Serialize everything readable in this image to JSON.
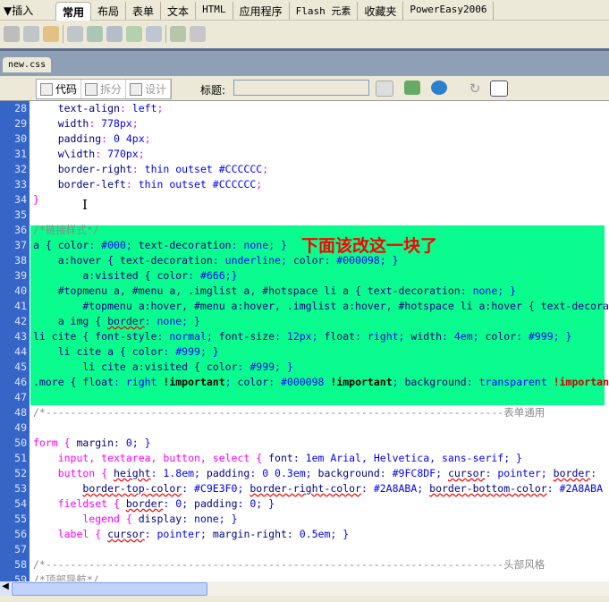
{
  "insert_bar": {
    "title": "▼插入",
    "tabs": [
      "常用",
      "布局",
      "表单",
      "文本",
      "HTML",
      "应用程序",
      "Flash 元素",
      "收藏夹",
      "PowerEasy2006"
    ],
    "active": "常用"
  },
  "icons": [
    "hyperlink-icon",
    "email-icon",
    "anchor-icon",
    "table-icon",
    "image-icon",
    "media-icon",
    "date-icon",
    "comment-icon",
    "template-icon",
    "tag-chooser-icon"
  ],
  "document": {
    "tab": "new.css"
  },
  "doc_toolbar": {
    "code": "代码",
    "split": "拆分",
    "design": "设计",
    "title_label": "标题:",
    "title_value": ""
  },
  "editor": {
    "lines": [
      {
        "n": "28",
        "t": [
          [
            "    text-align",
            "p"
          ],
          [
            ": ",
            "b"
          ],
          [
            "left",
            "v"
          ],
          [
            ";",
            "b"
          ]
        ]
      },
      {
        "n": "29",
        "t": [
          [
            "    width",
            "p"
          ],
          [
            ": ",
            "b"
          ],
          [
            "778px",
            "v"
          ],
          [
            ";",
            "b"
          ]
        ]
      },
      {
        "n": "30",
        "t": [
          [
            "    padding",
            "p"
          ],
          [
            ": ",
            "b"
          ],
          [
            "0 4px",
            "v"
          ],
          [
            ";",
            "b"
          ]
        ]
      },
      {
        "n": "31",
        "t": [
          [
            "    w\\idth",
            "p"
          ],
          [
            ": ",
            "b"
          ],
          [
            "770px",
            "v"
          ],
          [
            ";",
            "b"
          ]
        ]
      },
      {
        "n": "32",
        "t": [
          [
            "    border-right",
            "p"
          ],
          [
            ": ",
            "b"
          ],
          [
            "thin outset #CCCCCC",
            "v"
          ],
          [
            ";",
            "b"
          ]
        ]
      },
      {
        "n": "33",
        "t": [
          [
            "    border-left",
            "p"
          ],
          [
            ": ",
            "b"
          ],
          [
            "thin outset #CCCCCC",
            "v"
          ],
          [
            ";",
            "b"
          ]
        ]
      },
      {
        "n": "34",
        "t": [
          [
            "}",
            "b"
          ]
        ]
      },
      {
        "n": "35",
        "t": []
      },
      {
        "n": "36",
        "t": [
          [
            "/*链接样式*/",
            "c"
          ]
        ]
      },
      {
        "n": "37",
        "t": [
          [
            "a { ",
            "n"
          ],
          [
            "color",
            "p"
          ],
          [
            ": #000; ",
            "v"
          ],
          [
            "text-decoration",
            "p"
          ],
          [
            ": none; }",
            "v"
          ]
        ]
      },
      {
        "n": "38",
        "t": [
          [
            "    a:hover { ",
            "n"
          ],
          [
            "text-decoration",
            "p"
          ],
          [
            ": underline; ",
            "v"
          ],
          [
            "color",
            "p"
          ],
          [
            ": #000098; }",
            "v"
          ]
        ]
      },
      {
        "n": "39",
        "t": [
          [
            "        a:visited { ",
            "n"
          ],
          [
            "color",
            "p"
          ],
          [
            ": #666;}",
            "v"
          ]
        ]
      },
      {
        "n": "40",
        "t": [
          [
            "    #topmenu a, #menu a, .imglist a, #hotspace li a { ",
            "n"
          ],
          [
            "text-decoration",
            "p"
          ],
          [
            ": none; }",
            "v"
          ]
        ]
      },
      {
        "n": "41",
        "t": [
          [
            "        #topmenu a:hover, #menu a:hover, .imglist a:hover, #hotspace li a:hover { ",
            "n"
          ],
          [
            "text-decoration",
            "p"
          ]
        ]
      },
      {
        "n": "42",
        "t": [
          [
            "    a img { ",
            "n"
          ],
          [
            "border",
            "p u"
          ],
          [
            ": none; }",
            "v"
          ]
        ]
      },
      {
        "n": "43",
        "t": [
          [
            "li cite { ",
            "n"
          ],
          [
            "font-style",
            "p"
          ],
          [
            ": normal; ",
            "v"
          ],
          [
            "font-size",
            "p"
          ],
          [
            ": 12px; ",
            "v"
          ],
          [
            "float",
            "p"
          ],
          [
            ": right; ",
            "v"
          ],
          [
            "width",
            "p"
          ],
          [
            ": 4em; ",
            "v"
          ],
          [
            "color",
            "p"
          ],
          [
            ": #999; }",
            "v"
          ]
        ]
      },
      {
        "n": "44",
        "t": [
          [
            "    li cite a { ",
            "n"
          ],
          [
            "color",
            "p"
          ],
          [
            ": #999; }",
            "v"
          ]
        ]
      },
      {
        "n": "45",
        "t": [
          [
            "        li cite a:visited { ",
            "n"
          ],
          [
            "color",
            "p"
          ],
          [
            ": #999; }",
            "v"
          ]
        ]
      },
      {
        "n": "46",
        "t": [
          [
            ".more { ",
            "n"
          ],
          [
            "float",
            "p"
          ],
          [
            ": right ",
            "v"
          ],
          [
            "!important",
            "i"
          ],
          [
            "; ",
            "v"
          ],
          [
            "color",
            "p"
          ],
          [
            ": #000098 ",
            "v"
          ],
          [
            "!important",
            "i"
          ],
          [
            "; ",
            "v"
          ],
          [
            "background",
            "p"
          ],
          [
            ": transparent ",
            "v"
          ],
          [
            "!important",
            "r"
          ]
        ]
      },
      {
        "n": "47",
        "t": []
      },
      {
        "n": "48",
        "t": [
          [
            "/*--------------------------------------------------------------------------表单通用",
            "c"
          ]
        ]
      },
      {
        "n": "49",
        "t": []
      },
      {
        "n": "50",
        "t": [
          [
            "form ",
            "s"
          ],
          [
            "{ ",
            "b"
          ],
          [
            "margin",
            "p"
          ],
          [
            ": 0; }",
            "v"
          ]
        ]
      },
      {
        "n": "51",
        "t": [
          [
            "    input, textarea, button, select ",
            "s"
          ],
          [
            "{ ",
            "b"
          ],
          [
            "font",
            "p"
          ],
          [
            ": 1em Arial, Helvetica, sans-serif; }",
            "v"
          ]
        ]
      },
      {
        "n": "52",
        "t": [
          [
            "    button ",
            "s"
          ],
          [
            "{ ",
            "b"
          ],
          [
            "height",
            "p u"
          ],
          [
            ": 1.8em; ",
            "v"
          ],
          [
            "padding",
            "p"
          ],
          [
            ": 0 0.3em; ",
            "v"
          ],
          [
            "background",
            "p"
          ],
          [
            ": #9FC8DF; ",
            "v"
          ],
          [
            "cursor",
            "p u"
          ],
          [
            ": pointer; ",
            "v"
          ],
          [
            "border",
            "p u"
          ],
          [
            ":",
            "v"
          ]
        ]
      },
      {
        "n": "53",
        "t": [
          [
            "        ",
            "v"
          ],
          [
            "border-top-color",
            "p u"
          ],
          [
            ": #C9E3F0; ",
            "v"
          ],
          [
            "border-right-color",
            "p u"
          ],
          [
            ": #2A8ABA; ",
            "v"
          ],
          [
            "border-bottom-color",
            "p u"
          ],
          [
            ": #2A8ABA",
            "v"
          ]
        ]
      },
      {
        "n": "54",
        "t": [
          [
            "    fieldset ",
            "s"
          ],
          [
            "{ ",
            "b"
          ],
          [
            "border",
            "p u"
          ],
          [
            ": 0; ",
            "v"
          ],
          [
            "padding",
            "p"
          ],
          [
            ": 0; }",
            "v"
          ]
        ]
      },
      {
        "n": "55",
        "t": [
          [
            "        legend ",
            "s"
          ],
          [
            "{ ",
            "b"
          ],
          [
            "display",
            "p"
          ],
          [
            ": none; }",
            "v"
          ]
        ]
      },
      {
        "n": "56",
        "t": [
          [
            "    label ",
            "s"
          ],
          [
            "{ ",
            "b"
          ],
          [
            "cursor",
            "p u"
          ],
          [
            ": pointer; ",
            "v"
          ],
          [
            "margin-right",
            "p"
          ],
          [
            ": 0.5em; }",
            "v"
          ]
        ]
      },
      {
        "n": "57",
        "t": []
      },
      {
        "n": "58",
        "t": [
          [
            "/*--------------------------------------------------------------------------头部风格",
            "c"
          ]
        ]
      },
      {
        "n": "59",
        "t": [
          [
            "/*顶部导航*/",
            "c"
          ]
        ]
      }
    ],
    "annotation": "下面该改这一块了"
  },
  "colors": {
    "gutter": "#3565c6",
    "highlight": "#0bfc8e",
    "annotation": "#ff0000"
  }
}
